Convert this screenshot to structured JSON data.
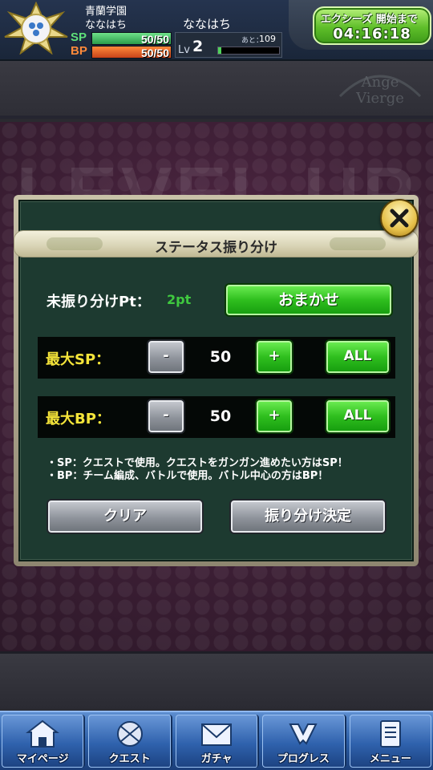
{
  "header": {
    "school": "青蘭学園",
    "player_small": "ななはち",
    "player_name": "ななはち",
    "sp": {
      "label": "SP",
      "value": "50/50"
    },
    "bp": {
      "label": "BP",
      "value": "50/50"
    },
    "level": {
      "label": "Lv",
      "value": "2",
      "exp_label": "あと：",
      "exp_remaining": "109",
      "exp_fill_fraction": 0.05
    },
    "event": {
      "title": "エクシーズ 開始まで",
      "timer": "04:16:18"
    }
  },
  "background": {
    "banner_text": "LEVEL UP",
    "logo_text": "Ange Vierge"
  },
  "dialog": {
    "title": "ステータス振り分け",
    "unassigned_label": "未振り分けPt：",
    "unassigned_value": "2pt",
    "omakase_label": "おまかせ",
    "sp_row": {
      "label": "最大SP：",
      "minus": "-",
      "value": "50",
      "plus": "+",
      "all": "ALL"
    },
    "bp_row": {
      "label": "最大BP：",
      "minus": "-",
      "value": "50",
      "plus": "+",
      "all": "ALL"
    },
    "notes": [
      "・SP：クエストで使用。クエストをガンガン進めたい方はSP！",
      "・BP：チーム編成、バトルで使用。バトル中心の方はBP！"
    ],
    "clear_label": "クリア",
    "decide_label": "振り分け決定"
  },
  "nav": [
    {
      "label": "マイページ",
      "icon": "home-icon"
    },
    {
      "label": "クエスト",
      "icon": "quest-emblem-icon"
    },
    {
      "label": "ガチャ",
      "icon": "envelope-icon"
    },
    {
      "label": "プログレス",
      "icon": "progress-ribbon-icon"
    },
    {
      "label": "メニュー",
      "icon": "book-menu-icon"
    }
  ],
  "colors": {
    "sp": "#5fe07a",
    "bp": "#ff8a3a",
    "dialog_bg": "#1d3a30",
    "stat_label": "#f5e53a",
    "pt_value": "#3fc93f",
    "nav": "#2c5fa8"
  }
}
